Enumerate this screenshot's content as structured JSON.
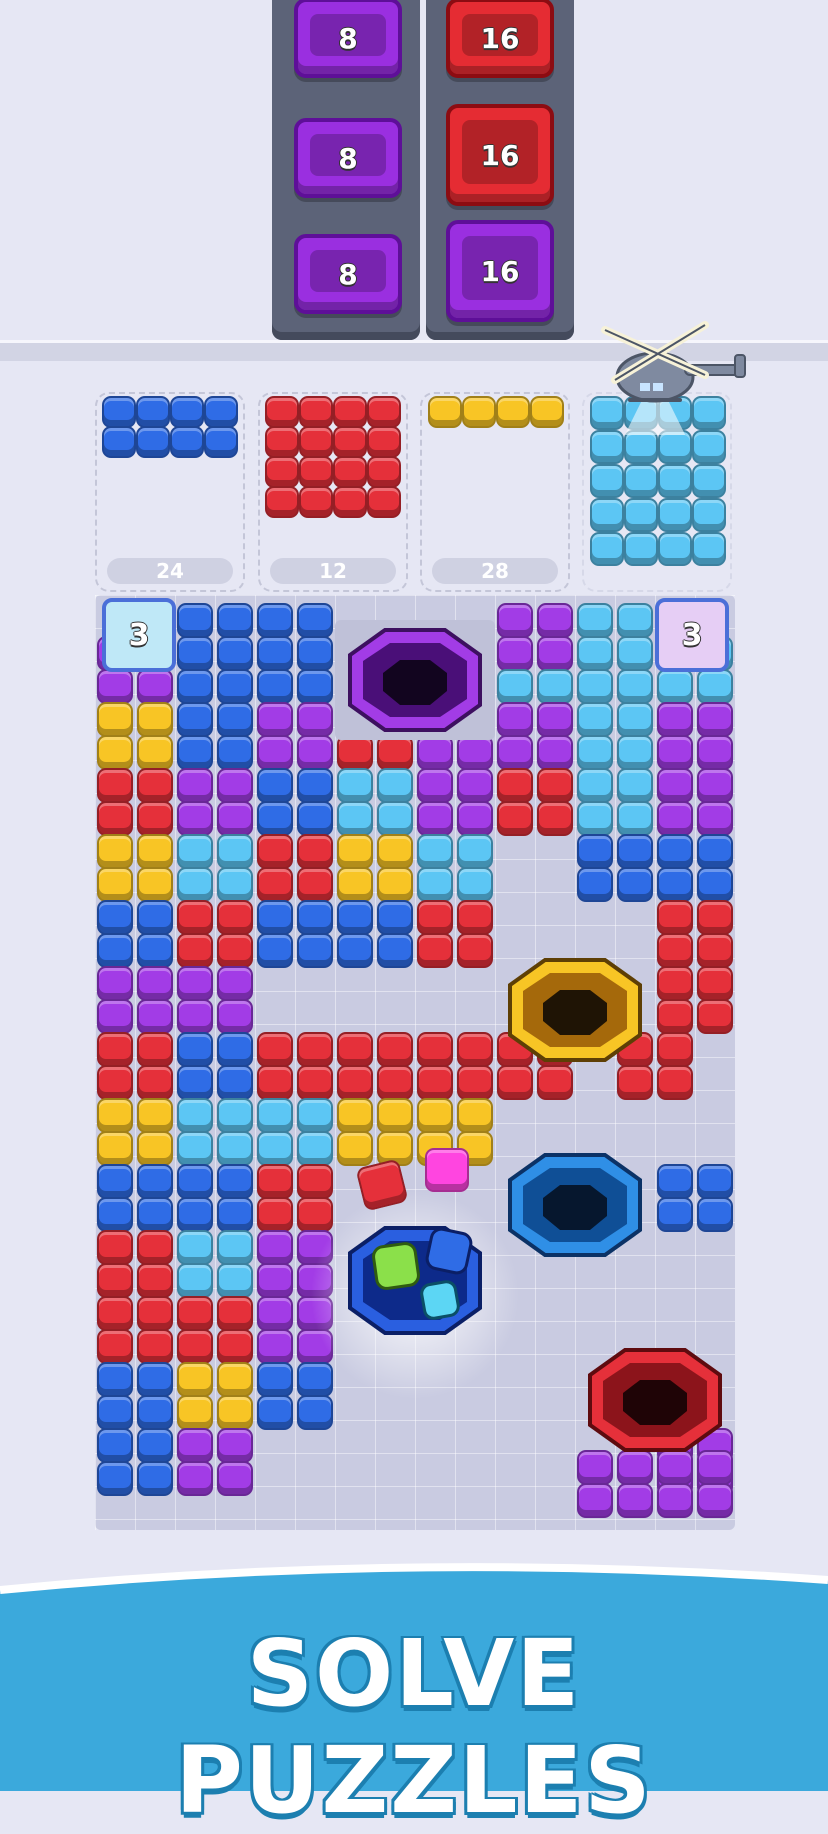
{
  "conveyor": {
    "left_column": [
      "8",
      "8",
      "8"
    ],
    "right_column": [
      "16",
      "16",
      "16"
    ],
    "right_column_colors": [
      "red",
      "red",
      "purple"
    ]
  },
  "slots": [
    {
      "count": "24",
      "color": "#2f6ce6"
    },
    {
      "count": "12",
      "color": "#e5303a"
    },
    {
      "count": "28",
      "color": "#f8c525"
    },
    {
      "count": "",
      "color": "#5cc6f4"
    }
  ],
  "badges": {
    "left_badge": "3",
    "right_badge": "3"
  },
  "colors": {
    "blue": "#2f6ce6",
    "red": "#e5303a",
    "yellow": "#f8c525",
    "purple": "#a23ce6",
    "cyan": "#5cc6f4",
    "magenta": "#ff45e0",
    "green": "#8be04a"
  },
  "holes": [
    "purple-hole",
    "yellow-hole",
    "blue-hole",
    "blue-hole-active",
    "red-hole"
  ],
  "helicopter": "helicopter-icon",
  "footer": {
    "title": "SOLVE PUZZLES"
  }
}
